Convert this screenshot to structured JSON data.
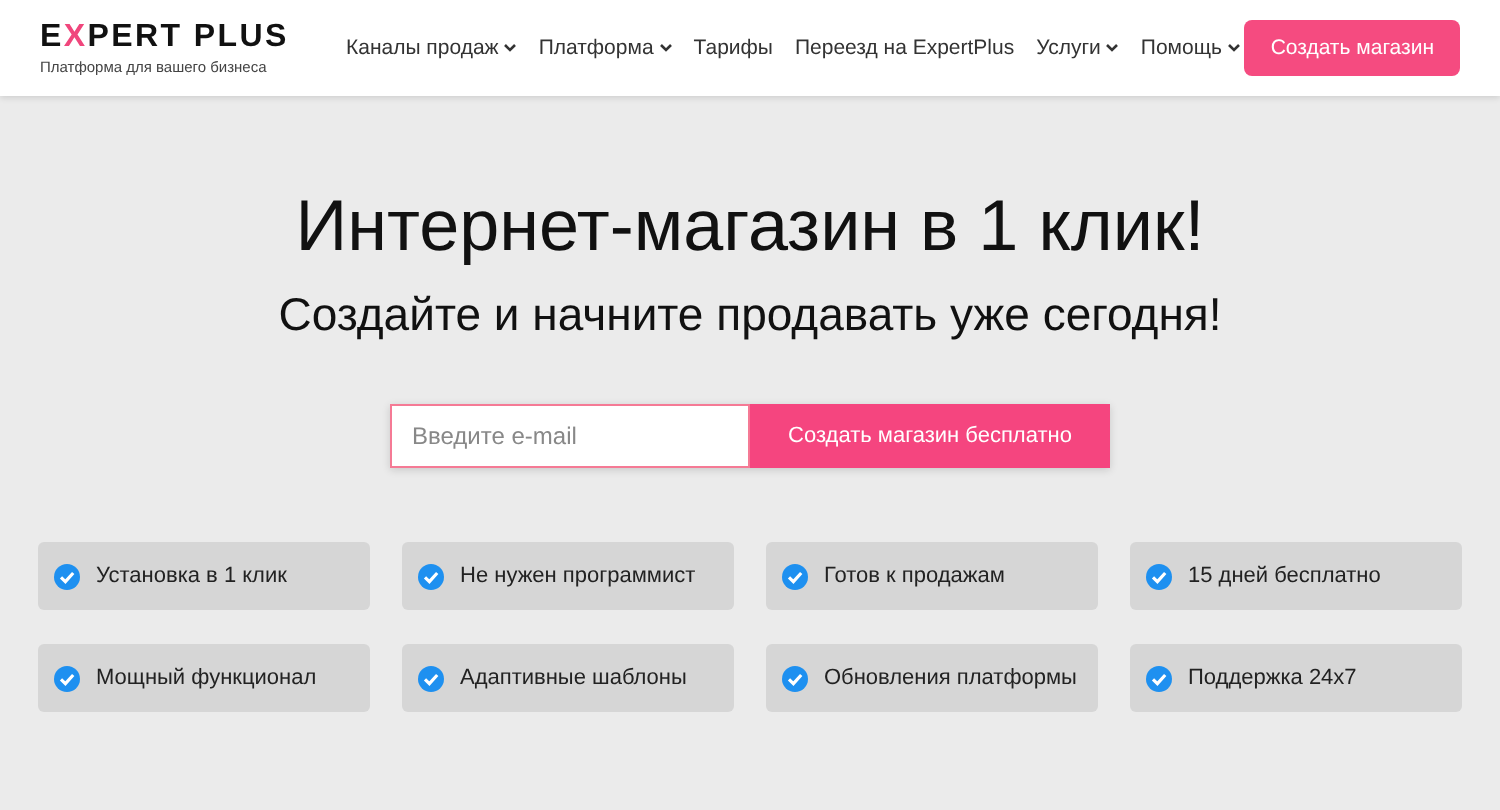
{
  "logo": {
    "parts": [
      {
        "text": "E",
        "accent": false
      },
      {
        "text": "X",
        "accent": true
      },
      {
        "text": "PERT PLUS",
        "accent": false
      }
    ],
    "tagline": "Платформа для вашего бизнеса"
  },
  "nav": [
    {
      "label": "Каналы продаж",
      "dropdown": true
    },
    {
      "label": "Платформа",
      "dropdown": true
    },
    {
      "label": "Тарифы",
      "dropdown": false
    },
    {
      "label": "Переезд на ExpertPlus",
      "dropdown": false
    },
    {
      "label": "Услуги",
      "dropdown": true
    },
    {
      "label": "Помощь",
      "dropdown": true
    }
  ],
  "header_button": "Создать магазин",
  "hero": {
    "title": "Интернет-магазин в 1 клик!",
    "subtitle": "Создайте и начните продавать уже сегодня!"
  },
  "signup": {
    "placeholder": "Введите e-mail",
    "button": "Создать магазин бесплатно"
  },
  "features": [
    {
      "label": "Установка в 1 клик",
      "checked": true
    },
    {
      "label": "Не нужен программист",
      "checked": true
    },
    {
      "label": "Готов к продажам",
      "checked": true
    },
    {
      "label": "15 дней бесплатно",
      "checked": true
    },
    {
      "label": "Мощный функционал",
      "checked": true
    },
    {
      "label": "Адаптивные шаблоны",
      "checked": true
    },
    {
      "label": "Обновления платформы",
      "checked": true
    },
    {
      "label": "Поддержка 24x7",
      "checked": true
    }
  ]
}
